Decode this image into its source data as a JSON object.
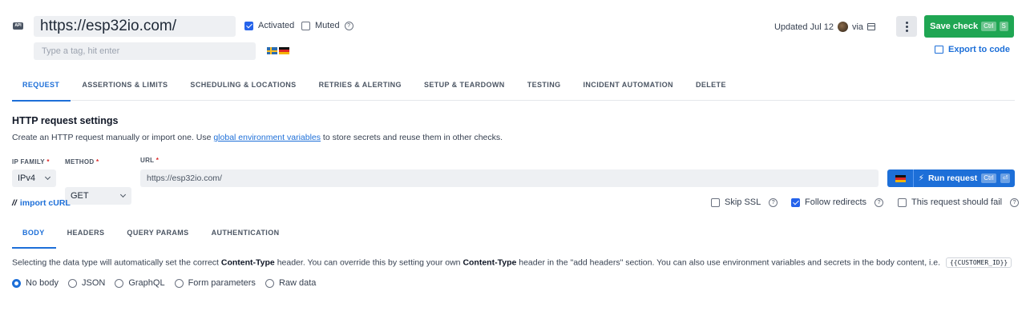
{
  "header": {
    "badge": "API",
    "check_name": "https://esp32io.com/",
    "tag_placeholder": "Type a tag, hit enter",
    "activated_label": "Activated",
    "muted_label": "Muted",
    "updated_text": "Updated Jul 12",
    "via_text": "via",
    "save_label": "Save check",
    "save_kbd_1": "Ctrl",
    "save_kbd_2": "S",
    "export_label": "Export to code"
  },
  "tabs": [
    {
      "label": "REQUEST"
    },
    {
      "label": "ASSERTIONS & LIMITS"
    },
    {
      "label": "SCHEDULING & LOCATIONS"
    },
    {
      "label": "RETRIES & ALERTING"
    },
    {
      "label": "SETUP & TEARDOWN"
    },
    {
      "label": "TESTING"
    },
    {
      "label": "INCIDENT AUTOMATION"
    },
    {
      "label": "DELETE"
    }
  ],
  "request": {
    "title": "HTTP request settings",
    "desc_before": "Create an HTTP request manually or import one. Use ",
    "desc_link": "global environment variables",
    "desc_after": " to store secrets and reuse them in other checks.",
    "ip_family_label": "IP FAMILY",
    "ip_family_value": "IPv4",
    "method_label": "METHOD",
    "method_value": "GET",
    "url_label": "URL",
    "url_value": "https://esp32io.com/",
    "required_mark": "*",
    "run_label": "Run request",
    "run_kbd_1": "Ctrl",
    "run_kbd_2": "⏎",
    "import_icon": "//",
    "import_label": "import cURL",
    "skip_ssl_label": "Skip SSL",
    "follow_redirects_label": "Follow redirects",
    "should_fail_label": "This request should fail"
  },
  "sub_tabs": [
    {
      "label": "BODY"
    },
    {
      "label": "HEADERS"
    },
    {
      "label": "QUERY PARAMS"
    },
    {
      "label": "AUTHENTICATION"
    }
  ],
  "body": {
    "desc_1": "Selecting the data type will automatically set the correct ",
    "desc_b1": "Content-Type",
    "desc_2": " header. You can override this by setting your own ",
    "desc_b2": "Content-Type",
    "desc_3": " header in the \"add headers\" section. You can also use environment variables and secrets in the body content, i.e. ",
    "code": "{{CUSTOMER_ID}}",
    "options": [
      {
        "label": "No body",
        "selected": true
      },
      {
        "label": "JSON",
        "selected": false
      },
      {
        "label": "GraphQL",
        "selected": false
      },
      {
        "label": "Form parameters",
        "selected": false
      },
      {
        "label": "Raw data",
        "selected": false
      }
    ]
  },
  "colors": {
    "accent": "#1d6fd8",
    "save": "#1fa653"
  }
}
